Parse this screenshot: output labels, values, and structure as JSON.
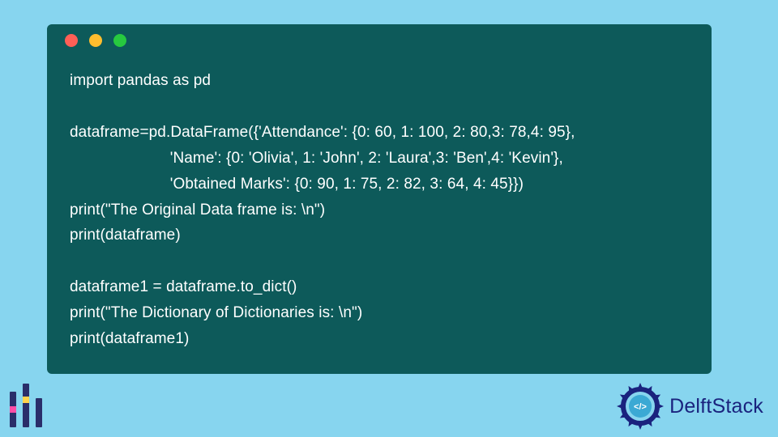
{
  "window": {
    "buttons": {
      "close": "close",
      "minimize": "minimize",
      "maximize": "maximize"
    }
  },
  "code": {
    "lines": [
      "import pandas as pd",
      "",
      "dataframe=pd.DataFrame({'Attendance': {0: 60, 1: 100, 2: 80,3: 78,4: 95},",
      "                       'Name': {0: 'Olivia', 1: 'John', 2: 'Laura',3: 'Ben',4: 'Kevin'},",
      "                       'Obtained Marks': {0: 90, 1: 75, 2: 82, 3: 64, 4: 45}})",
      "print(\"The Original Data frame is: \\n\")",
      "print(dataframe)",
      "",
      "dataframe1 = dataframe.to_dict()",
      "print(\"The Dictionary of Dictionaries is: \\n\")",
      "print(dataframe1)"
    ]
  },
  "brand": {
    "name": "DelftStack",
    "tag": "</>",
    "accent": "#1a237e"
  }
}
